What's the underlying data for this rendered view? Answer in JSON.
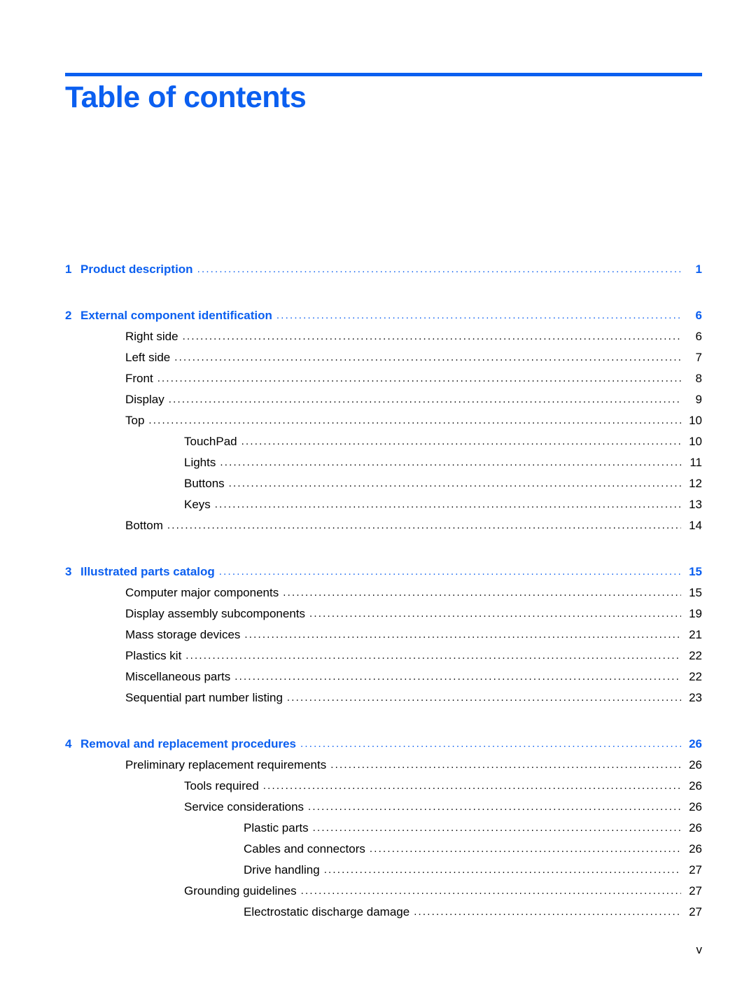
{
  "document": {
    "title": "Table of contents",
    "accent_color": "#0b5ff0",
    "footer_page_label": "v"
  },
  "toc": {
    "entries": [
      {
        "level": 0,
        "number": "1",
        "label": "Product description",
        "page": "1"
      },
      {
        "level": 0,
        "number": "2",
        "label": "External component identification",
        "page": "6"
      },
      {
        "level": 1,
        "number": "",
        "label": "Right side",
        "page": "6"
      },
      {
        "level": 1,
        "number": "",
        "label": "Left side",
        "page": "7"
      },
      {
        "level": 1,
        "number": "",
        "label": "Front",
        "page": "8"
      },
      {
        "level": 1,
        "number": "",
        "label": "Display",
        "page": "9"
      },
      {
        "level": 1,
        "number": "",
        "label": "Top",
        "page": "10"
      },
      {
        "level": 2,
        "number": "",
        "label": "TouchPad",
        "page": "10"
      },
      {
        "level": 2,
        "number": "",
        "label": "Lights",
        "page": "11"
      },
      {
        "level": 2,
        "number": "",
        "label": "Buttons",
        "page": "12"
      },
      {
        "level": 2,
        "number": "",
        "label": "Keys",
        "page": "13"
      },
      {
        "level": 1,
        "number": "",
        "label": "Bottom",
        "page": "14"
      },
      {
        "level": 0,
        "number": "3",
        "label": "Illustrated parts catalog",
        "page": "15"
      },
      {
        "level": 1,
        "number": "",
        "label": "Computer major components",
        "page": "15"
      },
      {
        "level": 1,
        "number": "",
        "label": "Display assembly subcomponents",
        "page": "19"
      },
      {
        "level": 1,
        "number": "",
        "label": "Mass storage devices",
        "page": "21"
      },
      {
        "level": 1,
        "number": "",
        "label": "Plastics kit",
        "page": "22"
      },
      {
        "level": 1,
        "number": "",
        "label": "Miscellaneous parts",
        "page": "22"
      },
      {
        "level": 1,
        "number": "",
        "label": "Sequential part number listing",
        "page": "23"
      },
      {
        "level": 0,
        "number": "4",
        "label": "Removal and replacement procedures",
        "page": "26"
      },
      {
        "level": 1,
        "number": "",
        "label": "Preliminary replacement requirements",
        "page": "26"
      },
      {
        "level": 2,
        "number": "",
        "label": "Tools required",
        "page": "26"
      },
      {
        "level": 2,
        "number": "",
        "label": "Service considerations",
        "page": "26"
      },
      {
        "level": 3,
        "number": "",
        "label": "Plastic parts",
        "page": "26"
      },
      {
        "level": 3,
        "number": "",
        "label": "Cables and connectors",
        "page": "26"
      },
      {
        "level": 3,
        "number": "",
        "label": "Drive handling",
        "page": "27"
      },
      {
        "level": 2,
        "number": "",
        "label": "Grounding guidelines",
        "page": "27"
      },
      {
        "level": 3,
        "number": "",
        "label": "Electrostatic discharge damage",
        "page": "27"
      }
    ]
  }
}
